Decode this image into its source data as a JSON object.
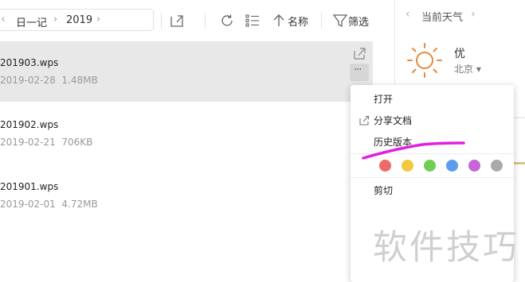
{
  "toolbar": {
    "breadcrumb": [
      "日一记",
      "2019"
    ],
    "sort_label": "名称",
    "filter_label": "筛选"
  },
  "files": [
    {
      "name": "201903.wps",
      "date": "2019-02-28",
      "size": "1.48MB",
      "selected": true
    },
    {
      "name": "201902.wps",
      "date": "2019-02-21",
      "size": "706KB",
      "selected": false
    },
    {
      "name": "201901.wps",
      "date": "2019-02-01",
      "size": "4.72MB",
      "selected": false
    }
  ],
  "weather": {
    "title": "当前天气",
    "air_quality": "优",
    "city": "北京",
    "icon": "sun-icon"
  },
  "context_menu": {
    "items": [
      "打开",
      "分享文档",
      "历史版本",
      "剪切"
    ],
    "tag_colors": [
      "#ee6a6a",
      "#f0c93c",
      "#6fcf53",
      "#5a9cf0",
      "#c665d6",
      "#aaaaaa"
    ]
  },
  "annotation": {
    "color": "#e020e0"
  },
  "watermark": "软件技巧"
}
